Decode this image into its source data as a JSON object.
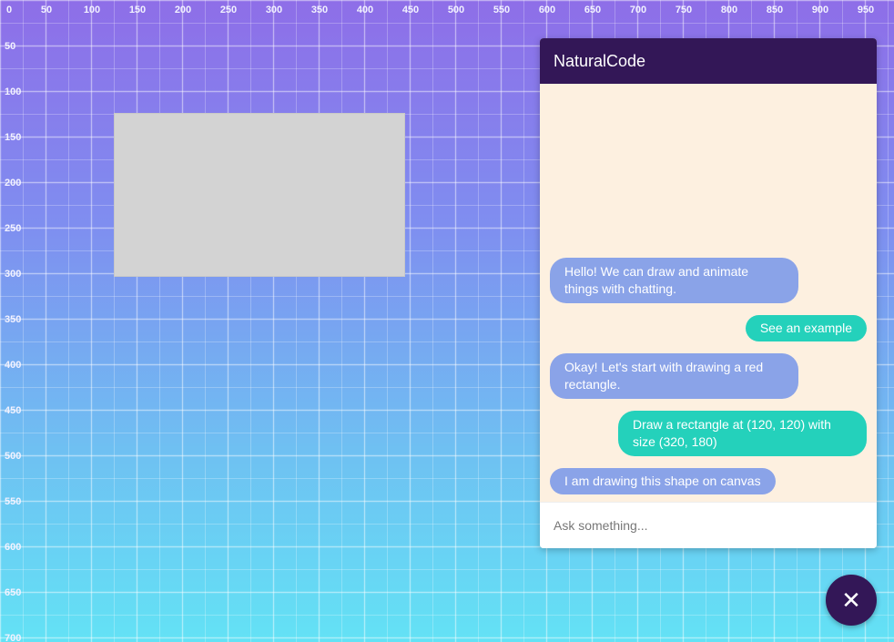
{
  "canvas": {
    "x_axis_labels": [
      "0",
      "50",
      "100",
      "150",
      "200",
      "250",
      "300",
      "350",
      "400",
      "450",
      "500",
      "550",
      "600",
      "650",
      "700",
      "750",
      "800",
      "850",
      "900",
      "950"
    ],
    "y_axis_labels": [
      "50",
      "100",
      "150",
      "200",
      "250",
      "300",
      "350",
      "400",
      "450",
      "500",
      "550",
      "600",
      "650",
      "700"
    ],
    "drawn_shape": {
      "type": "rectangle",
      "fill": "#d3d3d3"
    }
  },
  "chat": {
    "title": "NaturalCode",
    "messages": [
      {
        "role": "bot",
        "text": "Hello! We can draw and animate things with chatting."
      },
      {
        "role": "user",
        "text": "See an example"
      },
      {
        "role": "bot",
        "text": "Okay! Let's start with drawing a red rectangle."
      },
      {
        "role": "user",
        "text": "Draw a rectangle at (120, 120) with size (320, 180)"
      },
      {
        "role": "bot",
        "text": "I am drawing this shape on canvas"
      }
    ],
    "input_placeholder": "Ask something...",
    "input_value": ""
  },
  "fab": {
    "icon": "close-icon",
    "symbol": "✕"
  },
  "colors": {
    "header": "#331757",
    "bot_bubble": "#8aa3e8",
    "user_bubble": "#24d1bb",
    "chat_background": "#fdf0e0"
  }
}
